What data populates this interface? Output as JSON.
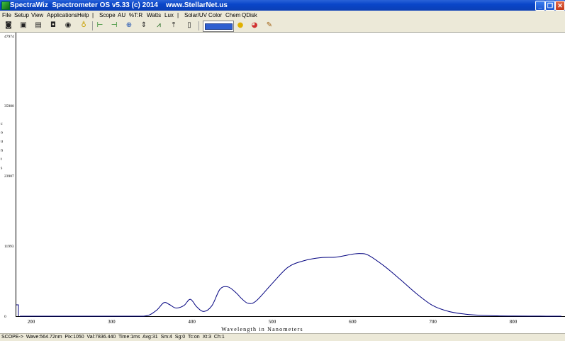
{
  "window": {
    "title": "SpectraWiz  Spectrometer OS v5.33 (c) 2014    www.StellarNet.us",
    "min_label": "_",
    "max_label": "❐",
    "close_label": "✕"
  },
  "menu": {
    "items": [
      "File",
      "Setup",
      "View",
      "Applications",
      "Help",
      "|",
      "Scope",
      "AU",
      "%T:R",
      "Watts",
      "Lux",
      "|",
      "Solar/UV",
      "Color",
      "Chem",
      "QDisk"
    ]
  },
  "toolbar": {
    "icons": [
      "camera-icon",
      "save-icon",
      "print-icon",
      "snapshot-icon",
      "eye-icon",
      "bulb-icon",
      "cursor-left-icon",
      "cursor-right-icon",
      "zoom-icon",
      "autoscale-y-icon",
      "peak-icon",
      "autoscale-icon",
      "page-icon",
      "color-swatch",
      "circle-icon",
      "color-wheel-icon",
      "pencil-icon"
    ],
    "swatch_color": "#2f5fd0"
  },
  "chart_data": {
    "type": "line",
    "xlabel": "Wavelength in Nanometers",
    "ylabel": "COUNTS",
    "x_ticks": [
      200,
      300,
      400,
      500,
      600,
      700,
      800
    ],
    "y_ticks": [
      0,
      11993,
      23987,
      35980,
      47974
    ],
    "xlim": [
      180,
      860
    ],
    "ylim": [
      0,
      47974
    ],
    "series": [
      {
        "color": "#00007f",
        "x": [
          180,
          183,
          186,
          189,
          192,
          200,
          250,
          300,
          340,
          355,
          365,
          372,
          380,
          390,
          398,
          406,
          415,
          425,
          435,
          445,
          455,
          462,
          470,
          480,
          500,
          520,
          540,
          560,
          580,
          600,
          610,
          620,
          640,
          660,
          680,
          700,
          720,
          740,
          760,
          780,
          800,
          830,
          860
        ],
        "y": [
          0,
          0,
          0,
          0,
          0,
          0,
          0,
          0,
          0,
          900,
          2300,
          2000,
          1400,
          1800,
          2900,
          1600,
          800,
          1800,
          4600,
          5000,
          4000,
          3000,
          2200,
          2600,
          5600,
          8400,
          9500,
          10000,
          10100,
          10600,
          10700,
          10400,
          8500,
          6200,
          3800,
          1800,
          800,
          350,
          150,
          60,
          30,
          10,
          5
        ]
      }
    ],
    "grid": false,
    "legend": "none"
  },
  "status": {
    "text": "SCOPE->  Wave:564.72nm  Pix:1050  Val:7836.440  Time:1ms  Avg:31  Sm:4  Sg:0  Tc:on  Xt:3  Ch:1"
  }
}
